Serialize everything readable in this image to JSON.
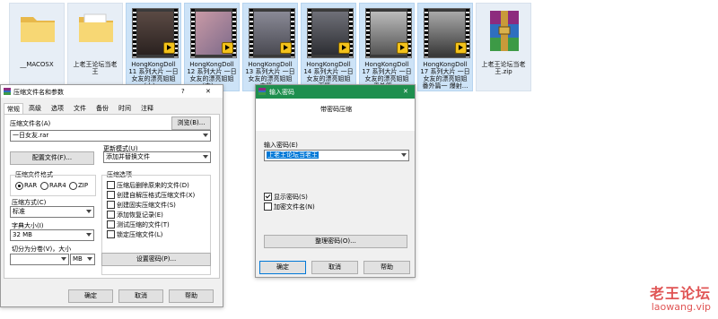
{
  "desktop": {
    "icons": [
      {
        "label": "__MACOSX",
        "kind": "folder"
      },
      {
        "label": "上老王论坛当老\n王",
        "kind": "folder"
      },
      {
        "label": "HongKongDoll\n11 系列大片 一日\n女友的漂亮姐姐\n(上) ...",
        "kind": "video"
      },
      {
        "label": "HongKongDoll\n12 系列大片 一日\n女友的漂亮姐姐\n(中) ...",
        "kind": "video"
      },
      {
        "label": "HongKongDoll\n13 系列大片 一日\n女友的漂亮姐姐\n中篇 ...",
        "kind": "video"
      },
      {
        "label": "HongKongDoll\n14 系列大片 一日\n女友的漂亮姐姐\n下篇 ...",
        "kind": "video"
      },
      {
        "label": "HongKongDoll\n17 系列大片 一日\n女友的漂亮姐姐\n番外篇 ...",
        "kind": "video"
      },
      {
        "label": "HongKongDoll\n17 系列大片 一日\n女友的漂亮姐姐\n番外篇一 爆射...",
        "kind": "video"
      },
      {
        "label": "上老王论坛当老\n王.zip",
        "kind": "archive"
      }
    ]
  },
  "archive_dialog": {
    "title": "压缩文件名和参数",
    "help_mark": "?",
    "close": "✕",
    "tabs": [
      "常规",
      "高级",
      "选项",
      "文件",
      "备份",
      "时间",
      "注释"
    ],
    "archive_name_label": "压缩文件名(A)",
    "browse_button": "浏览(B)...",
    "archive_name_value": "一日女友.rar",
    "profiles_button": "配置文件(F)...",
    "update_mode_label": "更新模式(U)",
    "update_mode_value": "添加并替换文件",
    "format_label": "压缩文件格式",
    "formats": [
      "RAR",
      "RAR4",
      "ZIP"
    ],
    "options_label": "压缩选项",
    "options": [
      {
        "label": "压缩后删除原来的文件(D)",
        "checked": false
      },
      {
        "label": "创建自解压格式压缩文件(X)",
        "checked": false
      },
      {
        "label": "创建固实压缩文件(S)",
        "checked": false
      },
      {
        "label": "添加恢复记录(E)",
        "checked": false
      },
      {
        "label": "测试压缩的文件(T)",
        "checked": false
      },
      {
        "label": "锁定压缩文件(L)",
        "checked": false
      }
    ],
    "method_label": "压缩方式(C)",
    "method_value": "标准",
    "dict_label": "字典大小(I)",
    "dict_value": "32 MB",
    "split_label": "切分为分卷(V)，大小",
    "split_unit": "MB",
    "set_password_button": "设置密码(P)...",
    "ok": "确定",
    "cancel": "取消",
    "help": "帮助"
  },
  "password_dialog": {
    "title": "输入密码",
    "close": "✕",
    "heading": "带密码压缩",
    "enter_label": "输入密码(E)",
    "password_value": "上老王论坛当老王",
    "show_password_label": "显示密码(S)",
    "show_password_checked": true,
    "encrypt_names_label": "加密文件名(N)",
    "encrypt_names_checked": false,
    "organize_button": "整理密码(O)...",
    "ok": "确定",
    "cancel": "取消",
    "help": "帮助",
    "accent": "#1e8f4e"
  },
  "watermark": {
    "line1": "老王论坛",
    "line2": "laowang.vip"
  }
}
